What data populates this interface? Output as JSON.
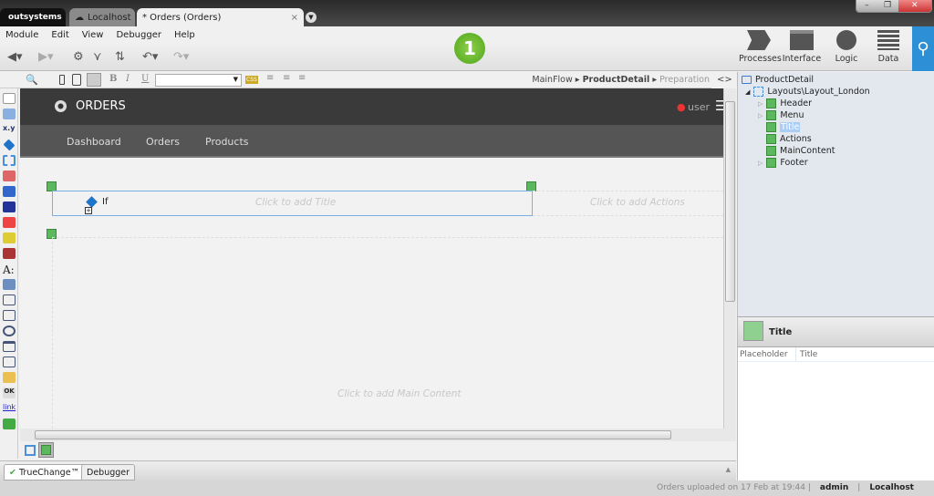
{
  "tabs": {
    "logo": "outsystems",
    "localhost": "Localhost",
    "active": "* Orders (Orders)",
    "close": "×"
  },
  "window": {
    "minimize": "–",
    "restore": "❐",
    "close": "✕"
  },
  "menu": [
    "Module",
    "Edit",
    "View",
    "Debugger",
    "Help"
  ],
  "step": "1",
  "main_buttons": [
    {
      "label": "Processes"
    },
    {
      "label": "Interface"
    },
    {
      "label": "Logic"
    },
    {
      "label": "Data"
    }
  ],
  "format": {
    "bold": "B",
    "italic": "I",
    "underline": "U",
    "css": "CSS",
    "font_value": ""
  },
  "breadcrumb": {
    "flow": "MainFlow",
    "screen": "ProductDetail",
    "current": "Preparation"
  },
  "app": {
    "title": "ORDERS",
    "user": "user",
    "nav": [
      "Dashboard",
      "Orders",
      "Products"
    ],
    "if_label": "If",
    "title_placeholder": "Click to add Title",
    "actions_placeholder": "Click to add Actions",
    "main_placeholder": "Click to add Main Content"
  },
  "bottom_tabs": [
    "TrueChange™",
    "Debugger"
  ],
  "status": {
    "message": "Orders uploaded on 17 Feb at 19:44",
    "sep": "|",
    "user": "admin",
    "server": "Localhost"
  },
  "tree": {
    "toggle": "<>",
    "root": "ProductDetail",
    "layout": "Layouts\\Layout_London",
    "items": [
      {
        "label": "Header",
        "expandable": true
      },
      {
        "label": "Menu",
        "expandable": true
      },
      {
        "label": "Title",
        "selected": true
      },
      {
        "label": "Actions"
      },
      {
        "label": "MainContent"
      },
      {
        "label": "Footer",
        "expandable": true
      }
    ]
  },
  "properties": {
    "title": "Title",
    "rows": [
      {
        "name": "Placeholder",
        "value": "Title"
      }
    ]
  },
  "colors": {
    "accent": "#2d8fd5",
    "green": "#4ea51c",
    "header": "#3a3a3a",
    "nav": "#555555"
  }
}
